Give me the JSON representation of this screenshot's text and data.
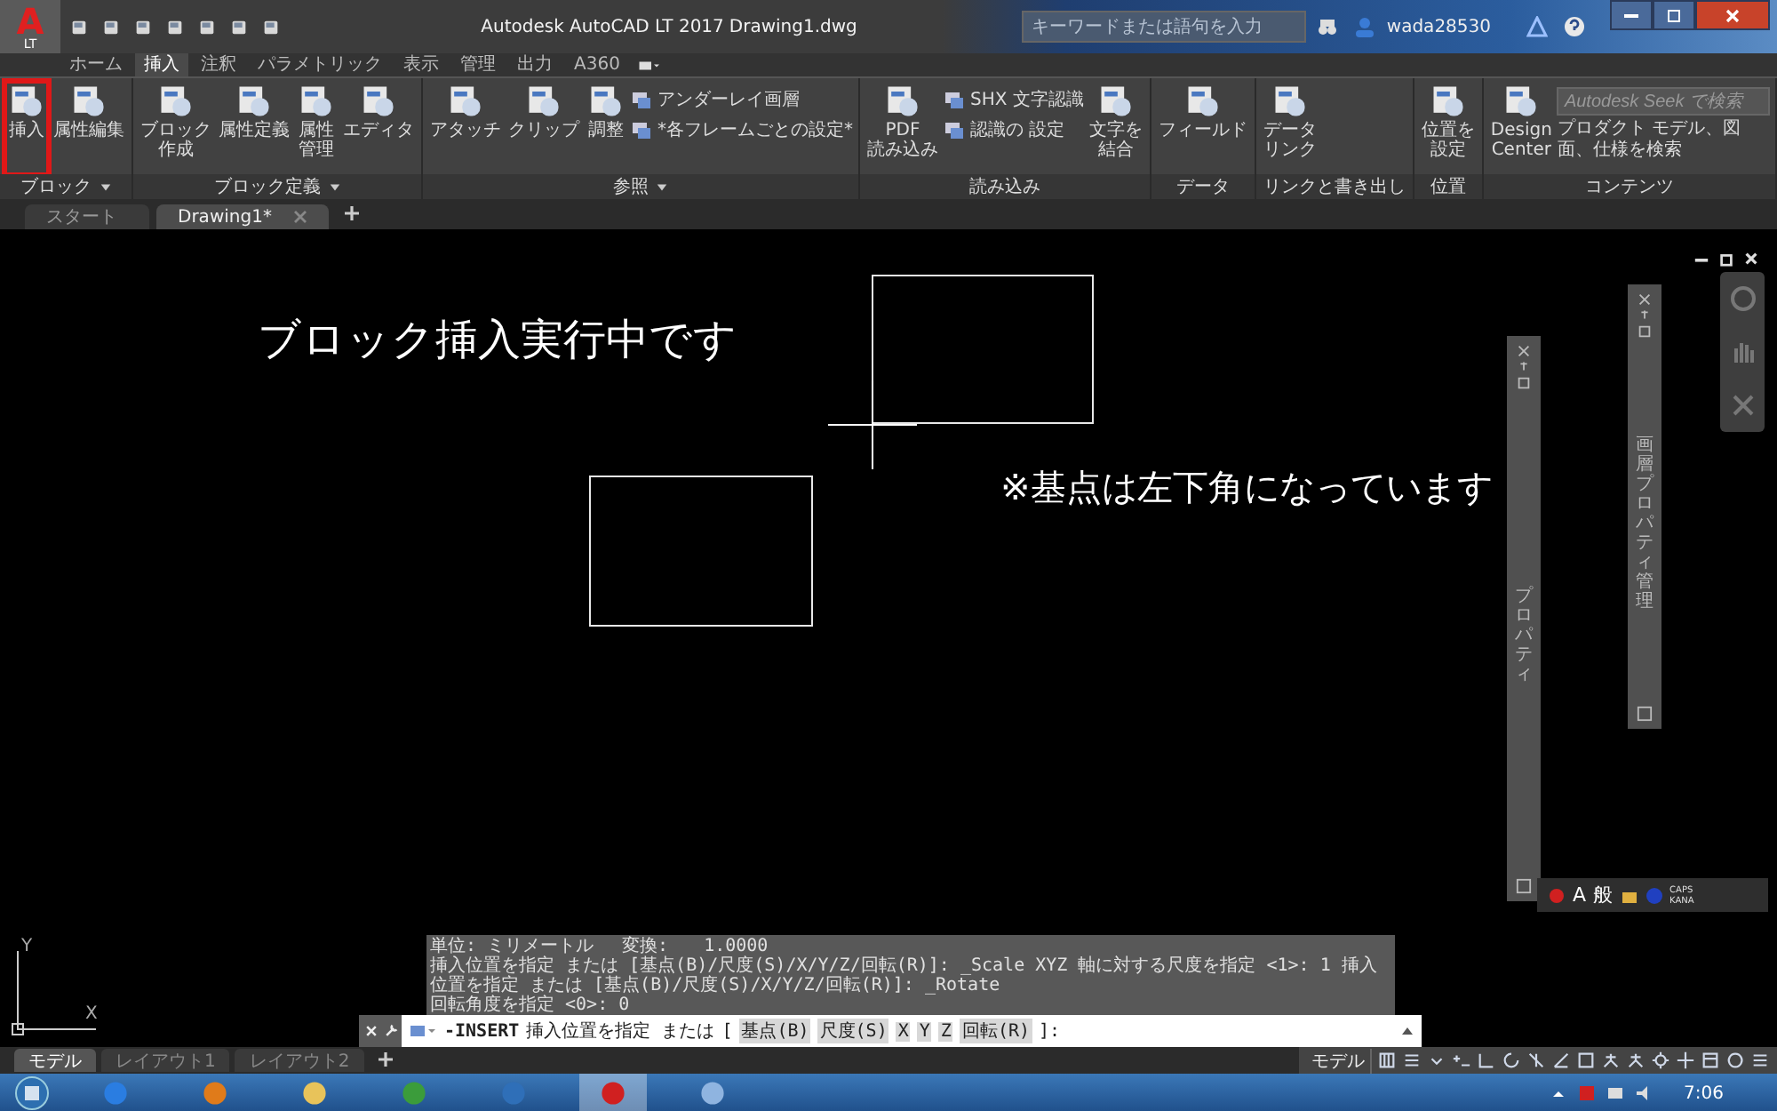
{
  "app_button": {
    "label": "A",
    "sublabel": "LT"
  },
  "title_bar": {
    "title": "Autodesk AutoCAD LT 2017",
    "document": "Drawing1.dwg",
    "search": {
      "placeholder": "キーワードまたは語句を入力"
    },
    "user": "wada28530"
  },
  "ribbon_tabs": [
    {
      "label": "ホーム",
      "selected": false
    },
    {
      "label": "挿入",
      "selected": true
    },
    {
      "label": "注釈",
      "selected": false
    },
    {
      "label": "パラメトリック",
      "selected": false
    },
    {
      "label": "表示",
      "selected": false
    },
    {
      "label": "管理",
      "selected": false
    },
    {
      "label": "出力",
      "selected": false
    },
    {
      "label": "A360",
      "selected": false
    }
  ],
  "panels": [
    {
      "title": "ブロック",
      "menu": true,
      "items": [
        {
          "kind": "large",
          "label": [
            "挿入"
          ],
          "highlighted": true
        },
        {
          "kind": "large",
          "label": [
            "属性編集"
          ],
          "highlighted": false
        }
      ]
    },
    {
      "title": "ブロック定義",
      "menu": true,
      "items": [
        {
          "kind": "large",
          "label": [
            "ブロック",
            "作成"
          ],
          "highlighted": false
        },
        {
          "kind": "large",
          "label": [
            "属性定義"
          ],
          "highlighted": false
        },
        {
          "kind": "large",
          "label": [
            "属性",
            "管理"
          ],
          "highlighted": false
        },
        {
          "kind": "large",
          "label": [
            "エディタ"
          ],
          "highlighted": false
        }
      ]
    },
    {
      "title": "参照",
      "menu": true,
      "items": [
        {
          "kind": "large",
          "label": [
            "アタッチ"
          ],
          "highlighted": false
        },
        {
          "kind": "large",
          "label": [
            "クリップ"
          ],
          "highlighted": false
        },
        {
          "kind": "large",
          "label": [
            "調整"
          ],
          "highlighted": false
        },
        {
          "kind": "stack",
          "lines": [
            "アンダーレイ画層",
            "*各フレームごとの設定*"
          ]
        }
      ]
    },
    {
      "title": "読み込み",
      "menu": false,
      "items": [
        {
          "kind": "large",
          "label": [
            "PDF",
            "読み込み"
          ],
          "highlighted": false
        },
        {
          "kind": "stack",
          "lines": [
            "SHX 文字認識",
            "認識の 設定"
          ]
        },
        {
          "kind": "large",
          "label": [
            "文字を",
            "結合"
          ],
          "highlighted": false
        }
      ]
    },
    {
      "title": "データ",
      "menu": false,
      "items": [
        {
          "kind": "large",
          "label": [
            "フィールド"
          ],
          "highlighted": false
        }
      ]
    },
    {
      "title": "リンクと書き出し",
      "menu": false,
      "items": [
        {
          "kind": "large",
          "label": [
            "データ",
            "リンク"
          ],
          "highlighted": false
        }
      ]
    },
    {
      "title": "位置",
      "menu": false,
      "items": [
        {
          "kind": "large",
          "label": [
            "位置を",
            "設定"
          ],
          "highlighted": false
        }
      ]
    },
    {
      "title": "コンテンツ",
      "menu": false,
      "items": [
        {
          "kind": "large",
          "label": [
            "Design",
            "Center"
          ],
          "highlighted": false
        },
        {
          "kind": "seek",
          "placeholder": "Autodesk Seek で検索",
          "caption": "プロダクト モデル、図面、仕様を検索"
        }
      ]
    }
  ],
  "doc_tabs": [
    {
      "label": "スタート",
      "selected": false
    },
    {
      "label": "Drawing1*",
      "selected": true
    }
  ],
  "canvas": {
    "notes": [
      {
        "text": "ブロック挿入実行中です",
        "kind": "title"
      },
      {
        "text": "※基点は左下角になっています",
        "kind": "note"
      }
    ],
    "ucs": {
      "x": "X",
      "y": "Y"
    },
    "palettes": [
      {
        "title": "プロパティ",
        "kind": "properties"
      },
      {
        "title": "画層プロパティ管理",
        "kind": "layers"
      }
    ],
    "ime": {
      "mode": "A",
      "input": "般",
      "caps": "CAPS",
      "kana": "KANA"
    }
  },
  "command_history": [
    "単位: ミリメートル　 変換:　　1.0000",
    "挿入位置を指定 または [基点(B)/尺度(S)/X/Y/Z/回転(R)]: _Scale XYZ 軸に対する尺度を指定 <1>: 1 挿入位置を指定 または [基点(B)/尺度(S)/X/Y/Z/回転(R)]: _Rotate",
    "回転角度を指定 <0>: 0"
  ],
  "command_line": {
    "command": "-INSERT",
    "prompt": "挿入位置を指定 または",
    "open": "[",
    "options": [
      "基点(B)",
      "尺度(S)",
      "X",
      "Y",
      "Z",
      "回転(R)"
    ],
    "close": "]:"
  },
  "layout_tabs": [
    {
      "label": "モデル",
      "selected": true
    },
    {
      "label": "レイアウト1",
      "selected": false
    },
    {
      "label": "レイアウト2",
      "selected": false
    }
  ],
  "status_bar": {
    "space": "モデル"
  },
  "taskbar": {
    "clock": "7:06"
  }
}
